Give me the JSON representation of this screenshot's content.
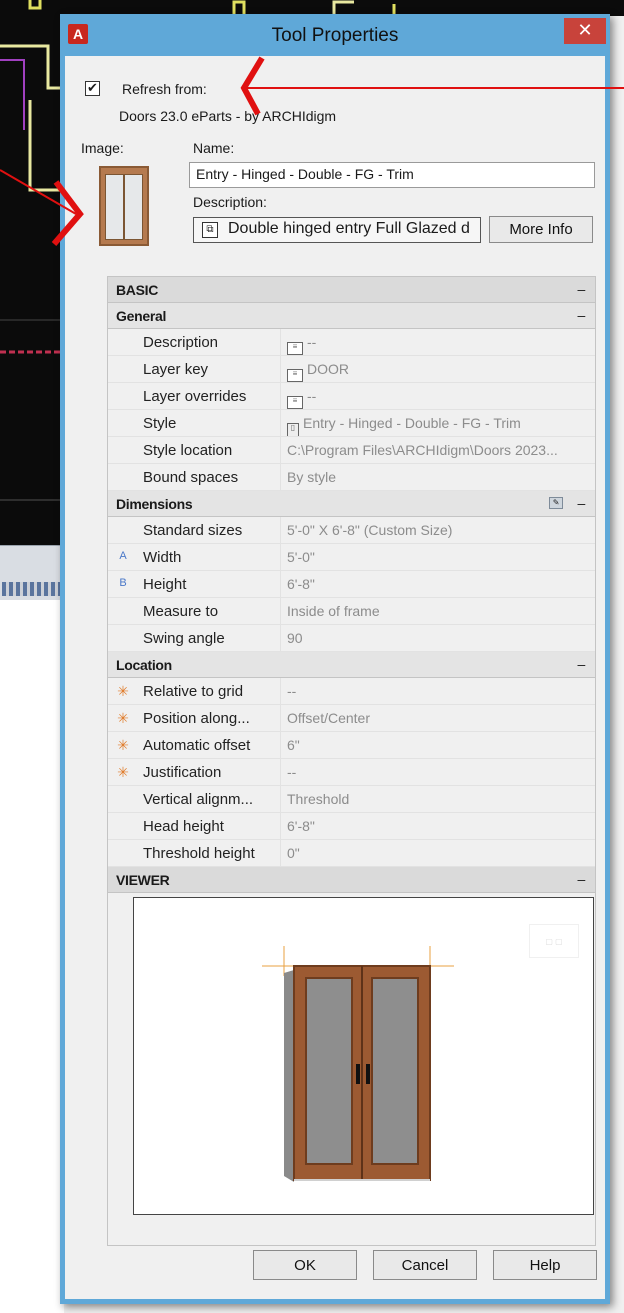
{
  "dialog": {
    "title": "Tool Properties",
    "close_glyph": "✕",
    "app_icon_letter": "A"
  },
  "refresh": {
    "checked_glyph": "✔",
    "label": "Refresh from:",
    "source": "Doors 23.0 eParts - by ARCHIdigm"
  },
  "image_label": "Image:",
  "name": {
    "label": "Name:",
    "value": "Entry - Hinged - Double - FG - Trim"
  },
  "description": {
    "label": "Description:",
    "value": "Double hinged entry Full Glazed d"
  },
  "more_info_button": "More Info",
  "sections": {
    "basic": "BASIC",
    "general": "General",
    "dimensions": "Dimensions",
    "location": "Location",
    "viewer": "VIEWER",
    "collapse_glyph": "–"
  },
  "general_rows": [
    {
      "name": "Description",
      "value": "--"
    },
    {
      "name": "Layer key",
      "value": "DOOR"
    },
    {
      "name": "Layer overrides",
      "value": "--"
    },
    {
      "name": "Style",
      "value": "Entry - Hinged - Double - FG - Trim"
    },
    {
      "name": "Style location",
      "value": "C:\\Program Files\\ARCHIdigm\\Doors 2023..."
    },
    {
      "name": "Bound spaces",
      "value": "By style"
    }
  ],
  "dimension_rows": [
    {
      "indicator": "",
      "name": "Standard sizes",
      "value": "5'-0\" X 6'-8\" (Custom Size)"
    },
    {
      "indicator": "A",
      "name": "Width",
      "value": "5'-0\""
    },
    {
      "indicator": "B",
      "name": "Height",
      "value": "6'-8\""
    },
    {
      "indicator": "",
      "name": "Measure to",
      "value": "Inside of frame"
    },
    {
      "indicator": "",
      "name": "Swing angle",
      "value": "90"
    }
  ],
  "location_rows": [
    {
      "indicator": "✳",
      "name": "Relative to grid",
      "value": "--"
    },
    {
      "indicator": "✳",
      "name": "Position along...",
      "value": "Offset/Center"
    },
    {
      "indicator": "✳",
      "name": "Automatic offset",
      "value": "6\""
    },
    {
      "indicator": "✳",
      "name": "Justification",
      "value": "--"
    },
    {
      "indicator": "",
      "name": "Vertical alignm...",
      "value": "Threshold"
    },
    {
      "indicator": "",
      "name": "Head height",
      "value": "6'-8\""
    },
    {
      "indicator": "",
      "name": "Threshold height",
      "value": "0\""
    }
  ],
  "buttons": {
    "ok": "OK",
    "cancel": "Cancel",
    "help": "Help"
  },
  "colors": {
    "title_bar": "#5fa8d8",
    "close": "#c8433b",
    "annotation": "#e01010",
    "door_wood": "#9c5a32",
    "door_glass": "#8e8e8e"
  },
  "icons": {
    "app": "autocad-icon",
    "close": "close-icon",
    "description": "description-icon",
    "layer": "layer-icon",
    "style": "door-style-icon",
    "dimension_tool": "dimension-tool-icon",
    "anchor": "anchor-icon"
  }
}
